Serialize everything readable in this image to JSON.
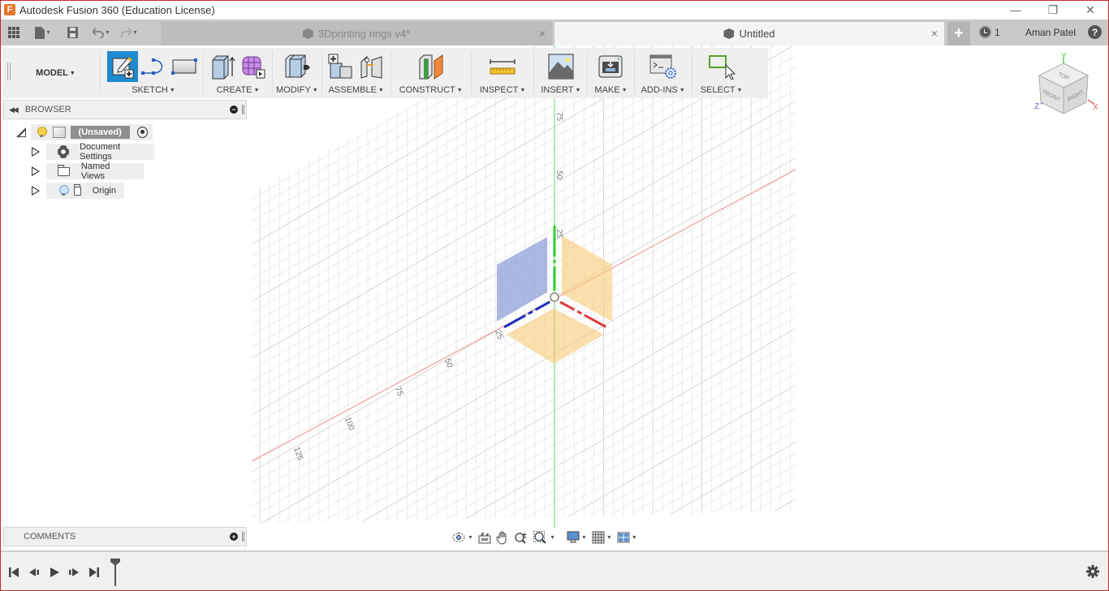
{
  "titlebar": {
    "app_logo": "F",
    "title": "Autodesk Fusion 360 (Education License)",
    "controls": {
      "minimize": "—",
      "restore": "❐",
      "close": "✕"
    }
  },
  "quick_access": {
    "items": [
      {
        "name": "data-panel",
        "icon": "grid-icon"
      },
      {
        "name": "file",
        "icon": "file-icon",
        "has_dropdown": true
      },
      {
        "name": "save",
        "icon": "save-icon"
      },
      {
        "name": "undo",
        "icon": "undo-icon",
        "has_dropdown": true
      },
      {
        "name": "redo",
        "icon": "redo-icon",
        "has_dropdown": true
      }
    ]
  },
  "tabs": [
    {
      "label": "3Dprinting rings v4*",
      "active": false,
      "close": "×"
    },
    {
      "label": "Untitled",
      "active": true,
      "close": "×"
    }
  ],
  "header_right": {
    "new_tab": "+",
    "job_status_count": "1",
    "user_name": "Aman Patel",
    "help": "?"
  },
  "toolbar": {
    "workspace": "MODEL",
    "groups": [
      {
        "label": "SKETCH",
        "icons": [
          "create-sketch-icon",
          "spline-icon",
          "rectangle-icon"
        ]
      },
      {
        "label": "CREATE",
        "icons": [
          "extrude-icon",
          "create-form-icon"
        ]
      },
      {
        "label": "MODIFY",
        "icons": [
          "press-pull-icon"
        ]
      },
      {
        "label": "ASSEMBLE",
        "icons": [
          "new-component-icon",
          "joint-icon"
        ]
      },
      {
        "label": "CONSTRUCT",
        "icons": [
          "offset-plane-icon"
        ]
      },
      {
        "label": "INSPECT",
        "icons": [
          "measure-icon"
        ]
      },
      {
        "label": "INSERT",
        "icons": [
          "insert-image-icon"
        ]
      },
      {
        "label": "MAKE",
        "icons": [
          "3d-print-icon"
        ]
      },
      {
        "label": "ADD-INS",
        "icons": [
          "scripts-addins-icon"
        ]
      },
      {
        "label": "SELECT",
        "icons": [
          "select-window-icon"
        ]
      }
    ]
  },
  "browser": {
    "title": "BROWSER",
    "root": {
      "label": "(Unsaved)"
    },
    "items": [
      {
        "label": "Document Settings",
        "icon": "gear-icon"
      },
      {
        "label": "Named Views",
        "icon": "folder-icon"
      },
      {
        "label": "Origin",
        "icon": "folder-icon",
        "visibility": "bulb-icon"
      }
    ]
  },
  "comments": {
    "title": "COMMENTS"
  },
  "viewcube": {
    "top": "TOP",
    "front": "FRONT",
    "right": "RIGHT",
    "x": "X",
    "y": "Y",
    "z": "Z"
  },
  "viewport": {
    "axis_colors": {
      "x": "#e03a3a",
      "y": "#2fcf2f",
      "z": "#2030c0"
    },
    "plane_colors": {
      "xy": "#f9c977",
      "yz": "#8fa0d8",
      "xz": "#f9c977"
    },
    "vertical_ticks": [
      "25",
      "50",
      "75"
    ],
    "x_axis_ticks": [
      "25",
      "50",
      "75",
      "100",
      "125"
    ]
  },
  "navbar": {
    "items": [
      "orbit-icon",
      "look-at-icon",
      "pan-icon",
      "zoom-icon",
      "fit-icon",
      "display-settings-icon",
      "grid-settings-icon",
      "viewports-icon"
    ]
  },
  "timeline": {
    "buttons": [
      "go-to-start",
      "step-back",
      "play",
      "step-forward",
      "go-to-end"
    ]
  }
}
